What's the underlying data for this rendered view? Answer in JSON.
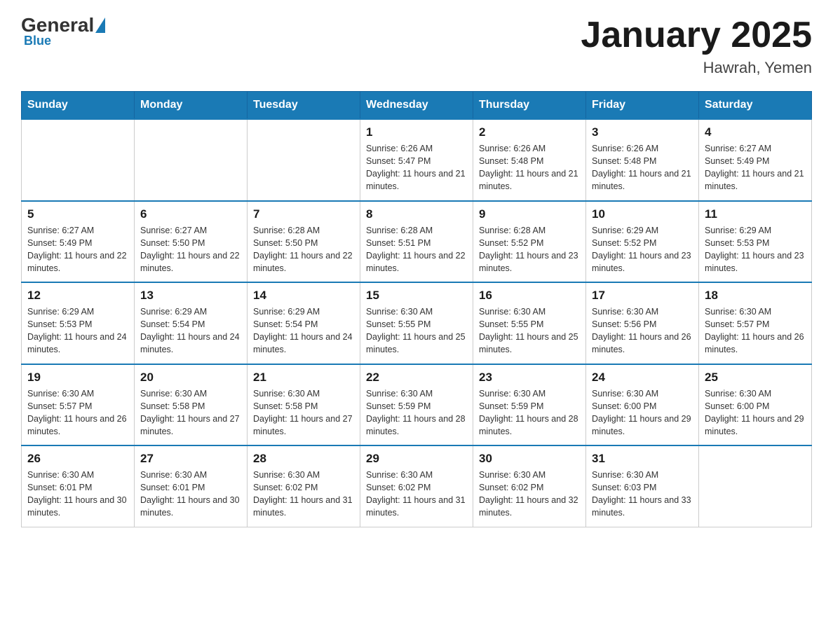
{
  "header": {
    "logo": {
      "general": "General",
      "blue": "Blue"
    },
    "title": "January 2025",
    "location": "Hawrah, Yemen"
  },
  "days_of_week": [
    "Sunday",
    "Monday",
    "Tuesday",
    "Wednesday",
    "Thursday",
    "Friday",
    "Saturday"
  ],
  "weeks": [
    [
      null,
      null,
      null,
      {
        "num": "1",
        "sunrise": "6:26 AM",
        "sunset": "5:47 PM",
        "daylight": "11 hours and 21 minutes."
      },
      {
        "num": "2",
        "sunrise": "6:26 AM",
        "sunset": "5:48 PM",
        "daylight": "11 hours and 21 minutes."
      },
      {
        "num": "3",
        "sunrise": "6:26 AM",
        "sunset": "5:48 PM",
        "daylight": "11 hours and 21 minutes."
      },
      {
        "num": "4",
        "sunrise": "6:27 AM",
        "sunset": "5:49 PM",
        "daylight": "11 hours and 21 minutes."
      }
    ],
    [
      {
        "num": "5",
        "sunrise": "6:27 AM",
        "sunset": "5:49 PM",
        "daylight": "11 hours and 22 minutes."
      },
      {
        "num": "6",
        "sunrise": "6:27 AM",
        "sunset": "5:50 PM",
        "daylight": "11 hours and 22 minutes."
      },
      {
        "num": "7",
        "sunrise": "6:28 AM",
        "sunset": "5:50 PM",
        "daylight": "11 hours and 22 minutes."
      },
      {
        "num": "8",
        "sunrise": "6:28 AM",
        "sunset": "5:51 PM",
        "daylight": "11 hours and 22 minutes."
      },
      {
        "num": "9",
        "sunrise": "6:28 AM",
        "sunset": "5:52 PM",
        "daylight": "11 hours and 23 minutes."
      },
      {
        "num": "10",
        "sunrise": "6:29 AM",
        "sunset": "5:52 PM",
        "daylight": "11 hours and 23 minutes."
      },
      {
        "num": "11",
        "sunrise": "6:29 AM",
        "sunset": "5:53 PM",
        "daylight": "11 hours and 23 minutes."
      }
    ],
    [
      {
        "num": "12",
        "sunrise": "6:29 AM",
        "sunset": "5:53 PM",
        "daylight": "11 hours and 24 minutes."
      },
      {
        "num": "13",
        "sunrise": "6:29 AM",
        "sunset": "5:54 PM",
        "daylight": "11 hours and 24 minutes."
      },
      {
        "num": "14",
        "sunrise": "6:29 AM",
        "sunset": "5:54 PM",
        "daylight": "11 hours and 24 minutes."
      },
      {
        "num": "15",
        "sunrise": "6:30 AM",
        "sunset": "5:55 PM",
        "daylight": "11 hours and 25 minutes."
      },
      {
        "num": "16",
        "sunrise": "6:30 AM",
        "sunset": "5:55 PM",
        "daylight": "11 hours and 25 minutes."
      },
      {
        "num": "17",
        "sunrise": "6:30 AM",
        "sunset": "5:56 PM",
        "daylight": "11 hours and 26 minutes."
      },
      {
        "num": "18",
        "sunrise": "6:30 AM",
        "sunset": "5:57 PM",
        "daylight": "11 hours and 26 minutes."
      }
    ],
    [
      {
        "num": "19",
        "sunrise": "6:30 AM",
        "sunset": "5:57 PM",
        "daylight": "11 hours and 26 minutes."
      },
      {
        "num": "20",
        "sunrise": "6:30 AM",
        "sunset": "5:58 PM",
        "daylight": "11 hours and 27 minutes."
      },
      {
        "num": "21",
        "sunrise": "6:30 AM",
        "sunset": "5:58 PM",
        "daylight": "11 hours and 27 minutes."
      },
      {
        "num": "22",
        "sunrise": "6:30 AM",
        "sunset": "5:59 PM",
        "daylight": "11 hours and 28 minutes."
      },
      {
        "num": "23",
        "sunrise": "6:30 AM",
        "sunset": "5:59 PM",
        "daylight": "11 hours and 28 minutes."
      },
      {
        "num": "24",
        "sunrise": "6:30 AM",
        "sunset": "6:00 PM",
        "daylight": "11 hours and 29 minutes."
      },
      {
        "num": "25",
        "sunrise": "6:30 AM",
        "sunset": "6:00 PM",
        "daylight": "11 hours and 29 minutes."
      }
    ],
    [
      {
        "num": "26",
        "sunrise": "6:30 AM",
        "sunset": "6:01 PM",
        "daylight": "11 hours and 30 minutes."
      },
      {
        "num": "27",
        "sunrise": "6:30 AM",
        "sunset": "6:01 PM",
        "daylight": "11 hours and 30 minutes."
      },
      {
        "num": "28",
        "sunrise": "6:30 AM",
        "sunset": "6:02 PM",
        "daylight": "11 hours and 31 minutes."
      },
      {
        "num": "29",
        "sunrise": "6:30 AM",
        "sunset": "6:02 PM",
        "daylight": "11 hours and 31 minutes."
      },
      {
        "num": "30",
        "sunrise": "6:30 AM",
        "sunset": "6:02 PM",
        "daylight": "11 hours and 32 minutes."
      },
      {
        "num": "31",
        "sunrise": "6:30 AM",
        "sunset": "6:03 PM",
        "daylight": "11 hours and 33 minutes."
      },
      null
    ]
  ]
}
